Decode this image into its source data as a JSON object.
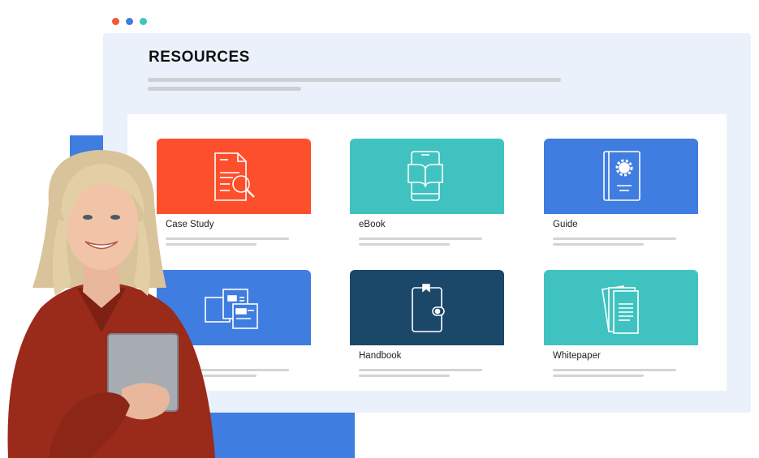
{
  "window": {
    "dots": [
      "#f05a3a",
      "#3f7de0",
      "#3fc4c1"
    ]
  },
  "page": {
    "title": "RESOURCES"
  },
  "cards": [
    {
      "label": "Case Study",
      "color": "#fe4f2d",
      "icon": "document-search-icon"
    },
    {
      "label": "eBook",
      "color": "#40c3c0",
      "icon": "ebook-icon"
    },
    {
      "label": "Guide",
      "color": "#3f7de0",
      "icon": "guide-book-icon"
    },
    {
      "label": "",
      "color": "#3f7de0",
      "icon": "layout-cards-icon"
    },
    {
      "label": "Handbook",
      "color": "#1b4769",
      "icon": "notebook-icon"
    },
    {
      "label": "Whitepaper",
      "color": "#40c3c0",
      "icon": "whitepaper-icon"
    }
  ]
}
